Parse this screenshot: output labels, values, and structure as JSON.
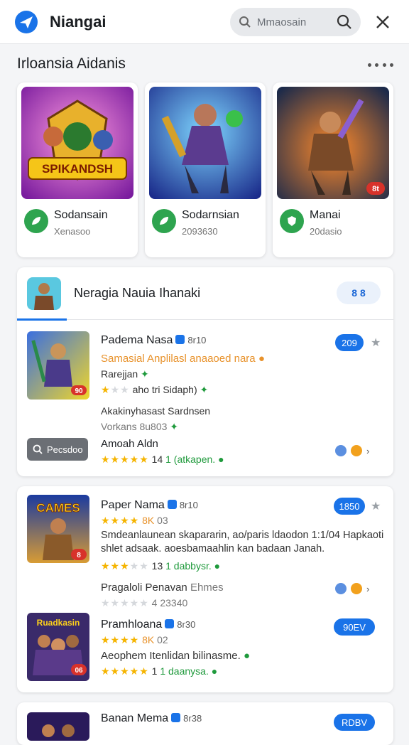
{
  "header": {
    "title": "Niangai",
    "search_placeholder": "Mmaosain"
  },
  "section": {
    "title": "Irloansia Aidanis"
  },
  "featured": [
    {
      "art_text": "SPIKANDSH",
      "name": "Sodansain",
      "sub": "Xenasoo"
    },
    {
      "art_text": "",
      "name": "Sodarnsian",
      "sub": "2093630"
    },
    {
      "art_text": "",
      "name": "Manai",
      "sub": "20dasio",
      "corner_badge": "8t"
    }
  ],
  "card1": {
    "head_title": "Neragia Nauia Ihanaki",
    "head_pill": "8 8",
    "games": [
      {
        "title": "Padema Nasa",
        "meta": "8r10",
        "line1": "Samasial Anplilasl anaaoed nara",
        "line2": "Rarejjan",
        "line3_rating": "aho",
        "line3_extra": "tri Sidaph)",
        "line4": "Akakinyhasast Sardnsen",
        "line5": "Vorkans 8u803",
        "pill": "209",
        "icon_badge": "90"
      },
      {
        "title": "Amoah Aldn",
        "rating_text": "14",
        "green_text": "1 (atkapen.",
        "chip": "Pecsdoo"
      }
    ]
  },
  "card2": {
    "games": [
      {
        "title": "Paper Nama",
        "meta": "8r10",
        "rating_note": "8K",
        "sub_meta": "03",
        "desc": "Smdeanlaunean skapararin, ao/paris ldaodon 1:1/04 Hapkaoti shlet adsaak. aoesbamaahlin kan badaan Janah.",
        "rating_text": "13",
        "green_text": "1 dabbysr.",
        "pill": "1850",
        "icon_title": "CAMES",
        "icon_badge": "8"
      },
      {
        "title": "Pragaloli Penavan",
        "title_gray": "Ehmes",
        "rating_text": "4 23340"
      },
      {
        "title": "Pramhloana",
        "meta": "8r30",
        "rating_note": "8K",
        "sub_meta": "02",
        "desc": "Aeophem Itenlidan bilinasme.",
        "rating_text": "1",
        "green_text": "1 daanysa.",
        "pill": "90EV",
        "icon_title": "Ruadkasin",
        "icon_badge": "06"
      }
    ]
  },
  "card3": {
    "title": "Banan Mema",
    "meta": "8r38",
    "pill": "RDBV"
  },
  "colors": {
    "accent": "#1a73e8",
    "green": "#2ea44f",
    "star": "#f5b400"
  }
}
